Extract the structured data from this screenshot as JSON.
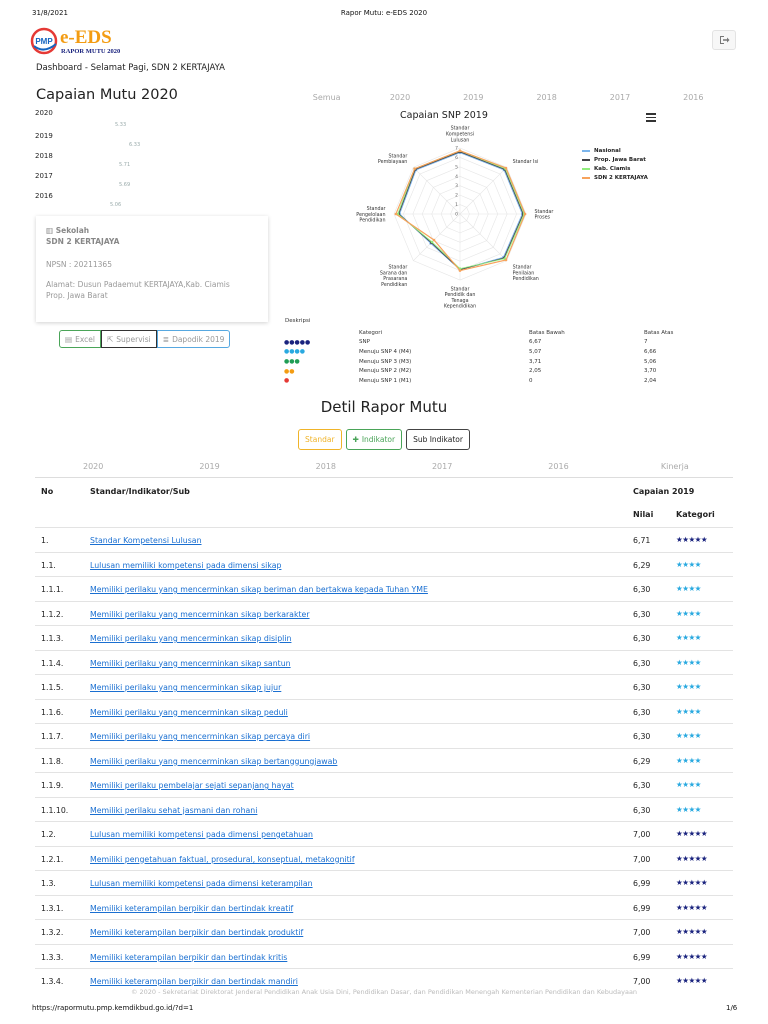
{
  "print": {
    "date": "31/8/2021",
    "title": "Rapor Mutu: e-EDS 2020",
    "url": "https://rapormutu.pmp.kemdikbud.go.id/?d=1",
    "page": "1/6"
  },
  "logo": {
    "badge": "PMP",
    "name": "e-EDS",
    "sub": "RAPOR MUTU 2020"
  },
  "breadcrumb": "Dashboard - Selamat Pagi, SDN 2 KERTAJAYA",
  "capaian": {
    "title": "Capaian Mutu 2020",
    "tabs": [
      "Semua",
      "2020",
      "2019",
      "2018",
      "2017",
      "2016"
    ],
    "years": [
      {
        "year": "2020",
        "value": "5.33"
      },
      {
        "year": "2019",
        "value": "6.33"
      },
      {
        "year": "2018",
        "value": "5.71"
      },
      {
        "year": "2017",
        "value": "5.69"
      },
      {
        "year": "2016",
        "value": "5.06"
      }
    ]
  },
  "school": {
    "label": "Sekolah",
    "name": "SDN 2 KERTAJAYA",
    "npsn": "NPSN : 20211365",
    "address_1": "Alamat: Dusun Padaemut KERTAJAYA,Kab. Ciamis",
    "address_2": "Prop. Jawa Barat"
  },
  "buttons": {
    "excel": "Excel",
    "supervisi": "Supervisi",
    "dapodik": "Dapodik 2019"
  },
  "chart_data": {
    "type": "radar",
    "title": "Capaian SNP 2019",
    "axes": [
      "Standar Kompetensi Lulusan",
      "Standar Isi",
      "Standar Proses",
      "Standar Penilaian Pendidikan",
      "Standar Pendidik dan Tenaga Kependidikan",
      "Standar Sarana dan Prasarana Pendidikan",
      "Standar Pengelolaan Pendidikan",
      "Standar Pembiayaan"
    ],
    "axis_labels": [
      [
        "Standar",
        "Kompetensi",
        "Lulusan"
      ],
      [
        "Standar Isi"
      ],
      [
        "Standar",
        "Proses"
      ],
      [
        "Standar",
        "Penilaian",
        "Pendidikan"
      ],
      [
        "Standar",
        "Pendidik dan",
        "Tenaga",
        "Kependidikan"
      ],
      [
        "Standar",
        "Sarana dan",
        "Prasarana",
        "Pendidikan"
      ],
      [
        "Standar",
        "Pengelolaan",
        "Pendidikan"
      ],
      [
        "Standar",
        "Pembiayaan"
      ]
    ],
    "rlim": [
      0,
      7
    ],
    "ticks": [
      "0",
      "1",
      "2",
      "3",
      "4",
      "5",
      "6",
      "7"
    ],
    "legend_position": "right",
    "series": [
      {
        "name": "Nasional",
        "color": "#7cb5ec",
        "values": [
          6.5,
          6.6,
          6.6,
          6.5,
          5.9,
          4.4,
          6.4,
          6.6
        ]
      },
      {
        "name": "Prop. Jawa Barat",
        "color": "#434348",
        "values": [
          6.6,
          6.7,
          6.7,
          6.6,
          5.9,
          4.3,
          6.5,
          6.7
        ]
      },
      {
        "name": "Kab. Ciamis",
        "color": "#90ed7d",
        "values": [
          6.7,
          6.8,
          6.8,
          6.7,
          5.8,
          4.2,
          6.6,
          6.8
        ]
      },
      {
        "name": "SDN 2 KERTAJAYA",
        "color": "#f7a35c",
        "values": [
          6.71,
          6.9,
          6.9,
          6.9,
          6.0,
          3.9,
          6.8,
          6.8
        ]
      }
    ]
  },
  "deskripsi": {
    "title": "Deskripsi",
    "headers": [
      "Kategori",
      "Batas Bawah",
      "Batas Atas"
    ],
    "rows": [
      {
        "stars": "●●●●●",
        "color": "#1a237e",
        "kategori": "SNP",
        "bawah": "6,67",
        "atas": "7"
      },
      {
        "stars": "●●●●",
        "color": "#29a9e0",
        "kategori": "Menuju SNP 4 (M4)",
        "bawah": "5,07",
        "atas": "6,66"
      },
      {
        "stars": "●●●",
        "color": "#1f9d55",
        "kategori": "Menuju SNP 3 (M3)",
        "bawah": "3,71",
        "atas": "5,06"
      },
      {
        "stars": "●●",
        "color": "#f39c12",
        "kategori": "Menuju SNP 2 (M2)",
        "bawah": "2,05",
        "atas": "3,70"
      },
      {
        "stars": "●",
        "color": "#e53935",
        "kategori": "Menuju SNP 1 (M1)",
        "bawah": "0",
        "atas": "2,04"
      }
    ]
  },
  "detil": {
    "title": "Detil Rapor Mutu",
    "tabs": {
      "standar": "Standar",
      "indikator": "Indikator",
      "sub": "Sub Indikator"
    },
    "years": [
      "2020",
      "2019",
      "2018",
      "2017",
      "2016",
      "Kinerja"
    ],
    "headers": {
      "no": "No",
      "item": "Standar/Indikator/Sub",
      "capaian": "Capaian 2019",
      "nilai": "Nilai",
      "kategori": "Kategori"
    },
    "rows": [
      {
        "no": "1.",
        "text": "Standar Kompetensi Lulusan",
        "nilai": "6,71",
        "stars": "★★★★★",
        "color": "#1a237e"
      },
      {
        "no": "1.1.",
        "text": "Lulusan memiliki kompetensi pada dimensi sikap",
        "nilai": "6,29",
        "stars": "★★★★",
        "color": "#29a9e0"
      },
      {
        "no": "1.1.1.",
        "text": "Memiliki perilaku yang mencerminkan sikap beriman dan bertakwa kepada Tuhan YME",
        "nilai": "6,30",
        "stars": "★★★★",
        "color": "#29a9e0"
      },
      {
        "no": "1.1.2.",
        "text": "Memiliki perilaku yang mencerminkan sikap berkarakter",
        "nilai": "6,30",
        "stars": "★★★★",
        "color": "#29a9e0"
      },
      {
        "no": "1.1.3.",
        "text": "Memiliki perilaku yang mencerminkan sikap disiplin",
        "nilai": "6,30",
        "stars": "★★★★",
        "color": "#29a9e0"
      },
      {
        "no": "1.1.4.",
        "text": "Memiliki perilaku yang mencerminkan sikap santun",
        "nilai": "6,30",
        "stars": "★★★★",
        "color": "#29a9e0"
      },
      {
        "no": "1.1.5.",
        "text": "Memiliki perilaku yang mencerminkan sikap jujur",
        "nilai": "6,30",
        "stars": "★★★★",
        "color": "#29a9e0"
      },
      {
        "no": "1.1.6.",
        "text": "Memiliki perilaku yang mencerminkan sikap peduli",
        "nilai": "6,30",
        "stars": "★★★★",
        "color": "#29a9e0"
      },
      {
        "no": "1.1.7.",
        "text": "Memiliki perilaku yang mencerminkan sikap percaya diri",
        "nilai": "6,30",
        "stars": "★★★★",
        "color": "#29a9e0"
      },
      {
        "no": "1.1.8.",
        "text": "Memiliki perilaku yang mencerminkan sikap bertanggungjawab",
        "nilai": "6,29",
        "stars": "★★★★",
        "color": "#29a9e0"
      },
      {
        "no": "1.1.9.",
        "text": "Memiliki perilaku pembelajar sejati sepanjang hayat",
        "nilai": "6,30",
        "stars": "★★★★",
        "color": "#29a9e0"
      },
      {
        "no": "1.1.10.",
        "text": "Memiliki perilaku sehat jasmani dan rohani",
        "nilai": "6,30",
        "stars": "★★★★",
        "color": "#29a9e0"
      },
      {
        "no": "1.2.",
        "text": "Lulusan memiliki kompetensi pada dimensi pengetahuan",
        "nilai": "7,00",
        "stars": "★★★★★",
        "color": "#1a237e"
      },
      {
        "no": "1.2.1.",
        "text": "Memiliki pengetahuan faktual, prosedural, konseptual, metakognitif",
        "nilai": "7,00",
        "stars": "★★★★★",
        "color": "#1a237e"
      },
      {
        "no": "1.3.",
        "text": "Lulusan memiliki kompetensi pada dimensi keterampilan",
        "nilai": "6,99",
        "stars": "★★★★★",
        "color": "#1a237e"
      },
      {
        "no": "1.3.1.",
        "text": "Memiliki keterampilan berpikir dan bertindak kreatif",
        "nilai": "6,99",
        "stars": "★★★★★",
        "color": "#1a237e"
      },
      {
        "no": "1.3.2.",
        "text": "Memiliki keterampilan berpikir dan bertindak produktif",
        "nilai": "7,00",
        "stars": "★★★★★",
        "color": "#1a237e"
      },
      {
        "no": "1.3.3.",
        "text": "Memiliki keterampilan berpikir dan bertindak kritis",
        "nilai": "6,99",
        "stars": "★★★★★",
        "color": "#1a237e"
      },
      {
        "no": "1.3.4.",
        "text": "Memiliki keterampilan berpikir dan bertindak mandiri",
        "nilai": "7,00",
        "stars": "★★★★★",
        "color": "#1a237e"
      }
    ]
  },
  "footer": "© 2020 - Sekretariat Direktorat Jenderal Pendidikan Anak Usia Dini, Pendidikan Dasar, dan Pendidikan Menengah Kementerian Pendidikan dan Kebudayaan"
}
